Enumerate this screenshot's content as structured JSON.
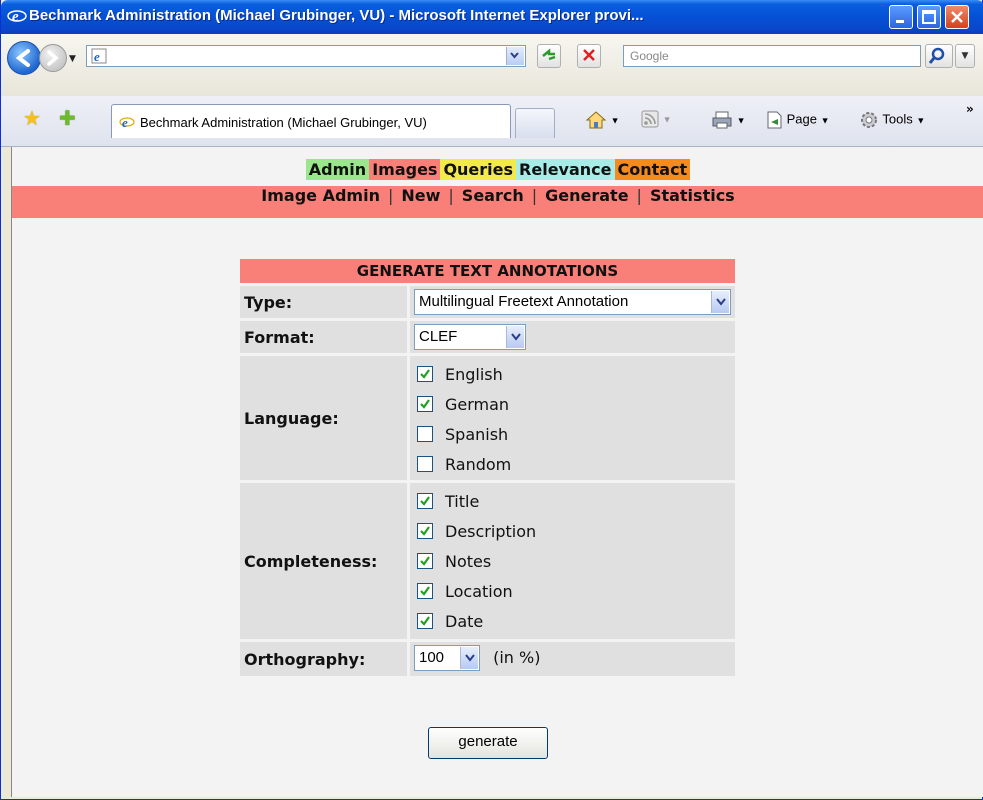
{
  "window": {
    "title": "Bechmark Administration (Michael Grubinger, VU) - Microsoft Internet Explorer provi..."
  },
  "browser": {
    "address_value": "",
    "search_placeholder": "Google",
    "tab_label": "Bechmark Administration (Michael Grubinger, VU)",
    "commands": {
      "page": "Page",
      "tools": "Tools"
    },
    "chevron": "»"
  },
  "nav": {
    "main": [
      {
        "label": "Admin",
        "color": "#9be68c"
      },
      {
        "label": "Images",
        "color": "#f98078"
      },
      {
        "label": "Queries",
        "color": "#f2ea4a"
      },
      {
        "label": "Relevance",
        "color": "#a7ece6"
      },
      {
        "label": "Contact",
        "color": "#f58a1f"
      }
    ],
    "sub": [
      "Image Admin",
      "New",
      "Search",
      "Generate",
      "Statistics"
    ],
    "sub_separator": "|"
  },
  "form": {
    "title": "GENERATE TEXT ANNOTATIONS",
    "type_label": "Type:",
    "type_value": "Multilingual Freetext Annotation",
    "format_label": "Format:",
    "format_value": "CLEF",
    "language_label": "Language:",
    "languages": [
      {
        "label": "English",
        "checked": true
      },
      {
        "label": "German",
        "checked": true
      },
      {
        "label": "Spanish",
        "checked": false
      },
      {
        "label": "Random",
        "checked": false
      }
    ],
    "completeness_label": "Completeness:",
    "completeness": [
      {
        "label": "Title",
        "checked": true
      },
      {
        "label": "Description",
        "checked": true
      },
      {
        "label": "Notes",
        "checked": true
      },
      {
        "label": "Location",
        "checked": true
      },
      {
        "label": "Date",
        "checked": true
      }
    ],
    "orthography_label": "Orthography:",
    "orthography_value": "100",
    "orthography_unit": "(in %)",
    "generate_label": "generate"
  }
}
